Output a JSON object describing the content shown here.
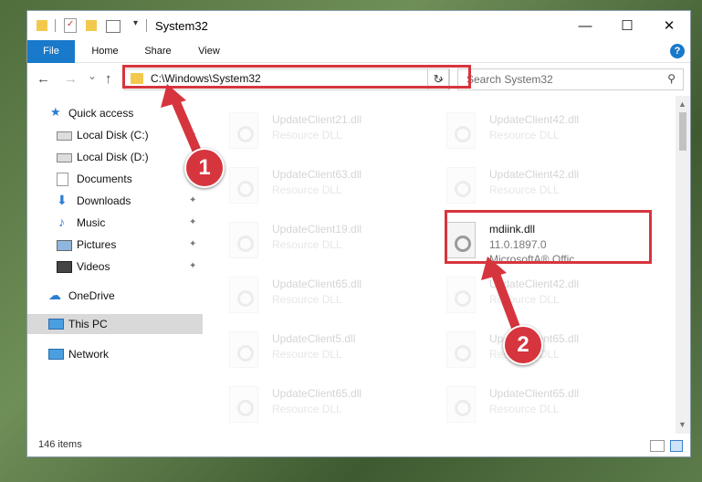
{
  "window": {
    "title": "System32",
    "controls": {
      "minimize": "—",
      "maximize": "☐",
      "close": "✕"
    }
  },
  "ribbon": {
    "tabs": [
      "File",
      "Home",
      "Share",
      "View"
    ],
    "help": "?"
  },
  "nav": {
    "back": "←",
    "forward": "→",
    "recent": "⌄",
    "up": "↑",
    "address": "C:\\Windows\\System32",
    "address_dropdown": "⌄",
    "refresh": "↻",
    "search_placeholder": "Search System32"
  },
  "sidebar": {
    "items": [
      {
        "label": "Quick access",
        "icon": "star-icon",
        "pinned": false
      },
      {
        "label": "Local Disk (C:)",
        "icon": "drive-icon",
        "pinned": true
      },
      {
        "label": "Local Disk (D:)",
        "icon": "drive-icon",
        "pinned": true
      },
      {
        "label": "Documents",
        "icon": "documents-icon",
        "pinned": true
      },
      {
        "label": "Downloads",
        "icon": "download-icon",
        "pinned": true
      },
      {
        "label": "Music",
        "icon": "music-icon",
        "pinned": true
      },
      {
        "label": "Pictures",
        "icon": "pictures-icon",
        "pinned": true
      },
      {
        "label": "Videos",
        "icon": "videos-icon",
        "pinned": true
      },
      {
        "label": "OneDrive",
        "icon": "cloud-icon",
        "pinned": false
      },
      {
        "label": "This PC",
        "icon": "computer-icon",
        "pinned": false,
        "selected": true
      },
      {
        "label": "Network",
        "icon": "network-icon",
        "pinned": false
      }
    ],
    "pin_glyph": "📌"
  },
  "files": [
    {
      "name": "UpdateClient21.dll",
      "type": "Resource DLL"
    },
    {
      "name": "UpdateClient42.dll",
      "type": "Resource DLL"
    },
    {
      "name": "UpdateClient63.dll",
      "type": "Resource DLL"
    },
    {
      "name": "UpdateClient42.dll",
      "type": "Resource DLL"
    },
    {
      "name": "UpdateClient19.dll",
      "type": "Resource DLL"
    },
    {
      "name": "mdiink.dll",
      "type": "11.0.1897.0",
      "type2": "MicrosoftA® Offic...",
      "highlighted": true
    },
    {
      "name": "UpdateClient65.dll",
      "type": "Resource DLL"
    },
    {
      "name": "UpdateClient42.dll",
      "type": "Resource DLL"
    },
    {
      "name": "UpdateClient5.dll",
      "type": "Resource DLL"
    },
    {
      "name": "UpdateClient65.dll",
      "type": "Resource DLL"
    },
    {
      "name": "UpdateClient65.dll",
      "type": "Resource DLL"
    },
    {
      "name": "UpdateClient65.dll",
      "type": "Resource DLL"
    }
  ],
  "status": {
    "item_count": "146 items"
  },
  "annotations": {
    "step1": "1",
    "step2": "2"
  },
  "colors": {
    "accent": "#1979ca",
    "highlight_red": "#d6353e"
  }
}
